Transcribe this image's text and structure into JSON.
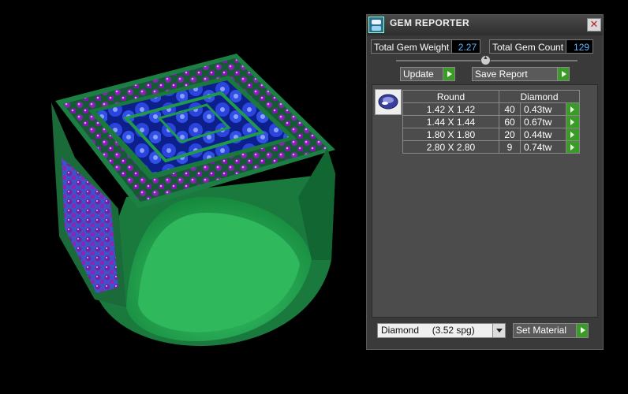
{
  "window": {
    "title": "GEM REPORTER",
    "close_label": "✕"
  },
  "stats": {
    "weight_label": "Total Gem Weight",
    "weight_value": "2.27",
    "count_label": "Total Gem Count",
    "count_value": "129"
  },
  "buttons": {
    "update": "Update",
    "save_report": "Save Report",
    "set_material": "Set Material"
  },
  "table": {
    "col1_header": "Round",
    "col2_header": "Diamond",
    "rows": [
      {
        "size": "1.42 X 1.42",
        "count": "40",
        "tw": "0.43tw"
      },
      {
        "size": "1.44 X 1.44",
        "count": "60",
        "tw": "0.67tw"
      },
      {
        "size": "1.80 X 1.80",
        "count": "20",
        "tw": "0.44tw"
      },
      {
        "size": "2.80 X 2.80",
        "count": "9",
        "tw": "0.74tw"
      }
    ]
  },
  "material_select": {
    "value": "Diamond     (3.52 spg)"
  },
  "colors": {
    "ring_green": "#1f8a4a",
    "stone_blue": "#2233cc",
    "bead_purple": "#8a1fb0",
    "value_text": "#5fb8ff",
    "go_green": "#3c9a2b"
  }
}
